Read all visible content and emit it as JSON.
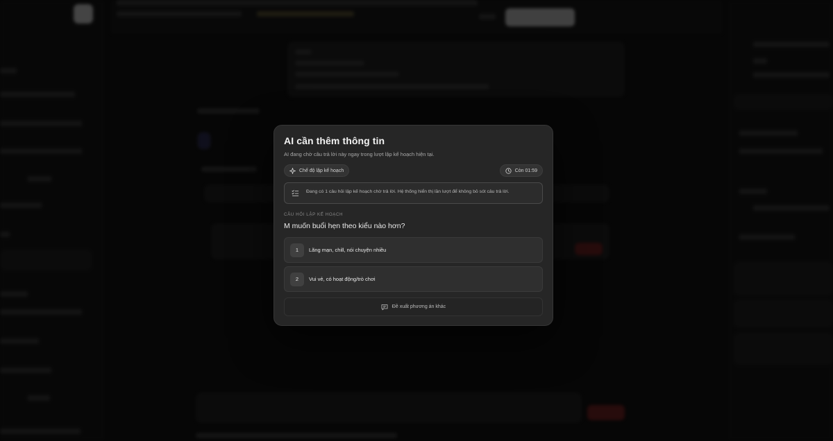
{
  "modal": {
    "title": "AI cần thêm thông tin",
    "subtitle": "AI đang chờ câu trả lời này ngay trong lượt lập kế hoạch hiện tại.",
    "mode_chip": "Chế độ lập kế hoạch",
    "timer_chip": "Còn 01:59",
    "notice": "Đang có 1 câu hỏi lập kế hoạch chờ trả lời. Hệ thống hiển thị lần lượt để không bỏ sót câu trả lời.",
    "section_label": "CÂU HỎI LẬP KẾ HOẠCH",
    "question": "M muốn buổi hẹn theo kiểu nào hơn?",
    "options": [
      {
        "number": "1",
        "label": "Lãng mạn, chill, nói chuyện nhiều"
      },
      {
        "number": "2",
        "label": "Vui vẻ, có hoạt động/trò chơi"
      }
    ],
    "suggest_label": "Đề xuất phương án khác"
  },
  "icons": {
    "mode": "sparkle-icon",
    "timer": "clock-icon",
    "notice": "list-check-icon",
    "suggest": "message-icon"
  }
}
